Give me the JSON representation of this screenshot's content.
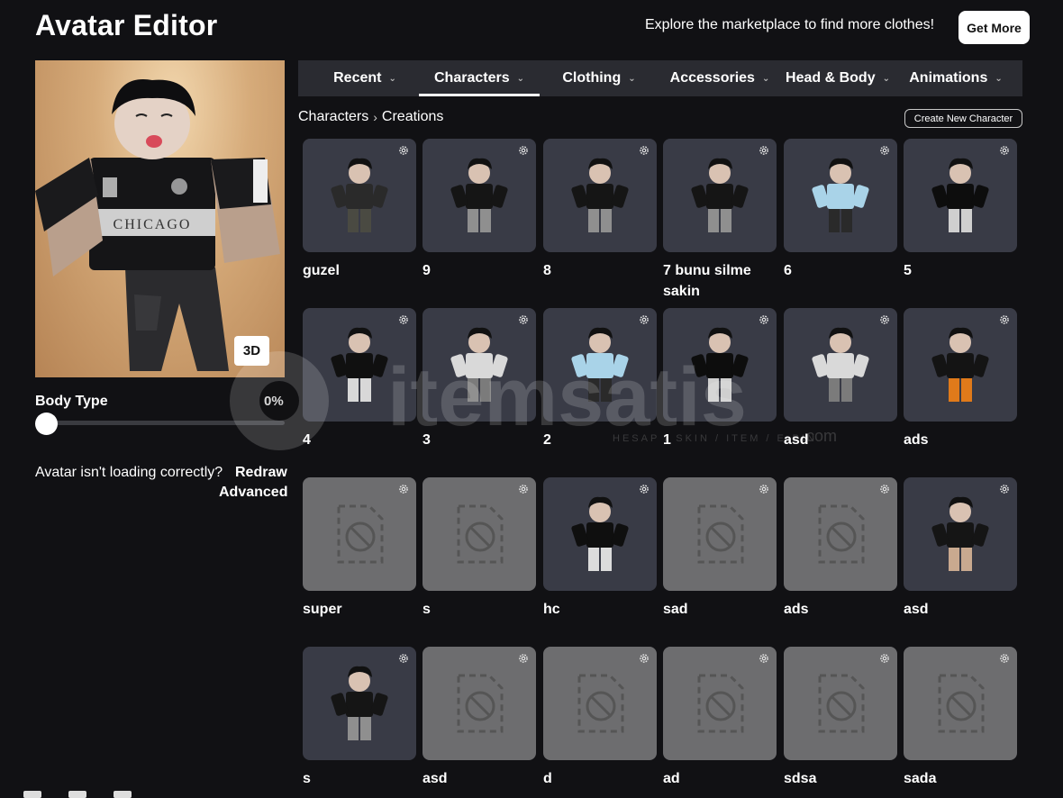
{
  "header": {
    "title": "Avatar Editor",
    "promo_text": "Explore the marketplace to find more clothes!",
    "get_more_label": "Get More"
  },
  "preview": {
    "view_toggle_label": "3D",
    "body_type_label": "Body Type",
    "body_type_value": "0%",
    "body_type_fraction": 0,
    "loading_text": "Avatar isn't loading correctly?",
    "redraw_label": "Redraw",
    "advanced_label": "Advanced"
  },
  "tabs": [
    {
      "label": "Recent",
      "active": false
    },
    {
      "label": "Characters",
      "active": true
    },
    {
      "label": "Clothing",
      "active": false
    },
    {
      "label": "Accessories",
      "active": false
    },
    {
      "label": "Head & Body",
      "active": false
    },
    {
      "label": "Animations",
      "active": false
    }
  ],
  "breadcrumb": {
    "root": "Characters",
    "current": "Creations"
  },
  "create_character_label": "Create New Character",
  "characters": [
    {
      "name": "guzel",
      "thumbnail": "dark-outfit"
    },
    {
      "name": "9",
      "thumbnail": "black-outfit"
    },
    {
      "name": "8",
      "thumbnail": "black-outfit"
    },
    {
      "name": "7 bunu silme sakin",
      "thumbnail": "black-outfit"
    },
    {
      "name": "6",
      "thumbnail": "light-blue-outfit"
    },
    {
      "name": "5",
      "thumbnail": "umbrella"
    },
    {
      "name": "4",
      "thumbnail": "spiky-hair"
    },
    {
      "name": "3",
      "thumbnail": "white-armor"
    },
    {
      "name": "2",
      "thumbnail": "light-blue-outfit"
    },
    {
      "name": "1",
      "thumbnail": "umbrella"
    },
    {
      "name": "asd",
      "thumbnail": "white-armor"
    },
    {
      "name": "ads",
      "thumbnail": "black-hood"
    },
    {
      "name": "super",
      "thumbnail": "missing"
    },
    {
      "name": "s",
      "thumbnail": "missing"
    },
    {
      "name": "hc",
      "thumbnail": "curly-hair"
    },
    {
      "name": "sad",
      "thumbnail": "missing"
    },
    {
      "name": "ads",
      "thumbnail": "missing"
    },
    {
      "name": "asd",
      "thumbnail": "chicago-outfit"
    },
    {
      "name": "s",
      "thumbnail": "black-outfit"
    },
    {
      "name": "asd",
      "thumbnail": "missing"
    },
    {
      "name": "d",
      "thumbnail": "missing"
    },
    {
      "name": "ad",
      "thumbnail": "missing"
    },
    {
      "name": "sdsa",
      "thumbnail": "missing"
    },
    {
      "name": "sada",
      "thumbnail": "missing"
    }
  ],
  "icons": {
    "settings": "gear-icon",
    "broken_image": "missing-image-icon",
    "dropdown": "chevron-down-icon"
  },
  "watermark": {
    "text": "itemsatis",
    "subtext": "HESAP / SKIN / ITEM / E-PIN",
    "suffix": ".com"
  }
}
